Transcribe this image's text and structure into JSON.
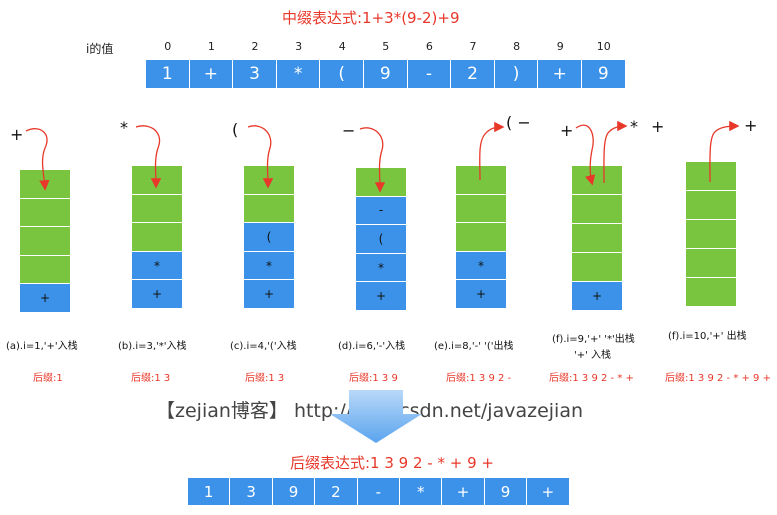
{
  "title": "中缀表达式:1+3*(9-2)+9",
  "index_label": "i的值",
  "indices": [
    "0",
    "1",
    "2",
    "3",
    "4",
    "5",
    "6",
    "7",
    "8",
    "9",
    "10"
  ],
  "infix_cells": [
    "1",
    "+",
    "3",
    "*",
    "(",
    "9",
    "-",
    "2",
    ")",
    "+",
    "9"
  ],
  "steps": [
    {
      "ops": [
        "+"
      ],
      "stack": [
        "",
        "",
        "",
        "",
        "+"
      ],
      "caption": "(a).i=1,'+'入栈",
      "caption2": "",
      "suffix": "后缀:1"
    },
    {
      "ops": [
        "*"
      ],
      "stack": [
        "",
        "",
        "",
        "*",
        "+"
      ],
      "caption": "(b).i=3,'*'入栈",
      "caption2": "",
      "suffix": "后缀:1 3"
    },
    {
      "ops": [
        "("
      ],
      "stack": [
        "",
        "",
        "(",
        "*",
        "+"
      ],
      "caption": "(c).i=4,'('入栈",
      "caption2": "",
      "suffix": "后缀:1 3"
    },
    {
      "ops": [
        "−"
      ],
      "stack": [
        "",
        "-",
        "(",
        "*",
        "+"
      ],
      "caption": "(d).i=6,'-'入栈",
      "caption2": "",
      "suffix": "后缀:1 3 9"
    },
    {
      "ops": [
        "( −"
      ],
      "stack": [
        "",
        "",
        "",
        "*",
        "+"
      ],
      "caption": "(e).i=8,'-' '('出栈",
      "caption2": "",
      "suffix": "后缀:1 3 9 2 -"
    },
    {
      "ops": [
        "+",
        "*",
        "+"
      ],
      "stack": [
        "",
        "",
        "",
        "",
        "+"
      ],
      "caption": "(f).i=9,'+' '*'出栈",
      "caption2": "'+' 入栈",
      "suffix": "后缀:1 3 9 2 - * +"
    },
    {
      "ops": [
        "+"
      ],
      "stack": [
        "",
        "",
        "",
        "",
        ""
      ],
      "caption": "(f).i=10,'+' 出栈",
      "caption2": "",
      "suffix": "后缀:1 3 9 2 - * + 9 +"
    }
  ],
  "watermark": "【zejian博客】 http://blog.csdn.net/javazejian",
  "postfix_title": "后缀表达式:1 3 9 2 - * + 9 +",
  "postfix_cells": [
    "1",
    "3",
    "9",
    "2",
    "-",
    "*",
    "+",
    "9",
    "+"
  ],
  "colors": {
    "accent_red": "#e8382a",
    "cell_blue": "#3b92e8",
    "stack_green": "#79c540",
    "arrow_blue": "#6fb0f0"
  }
}
